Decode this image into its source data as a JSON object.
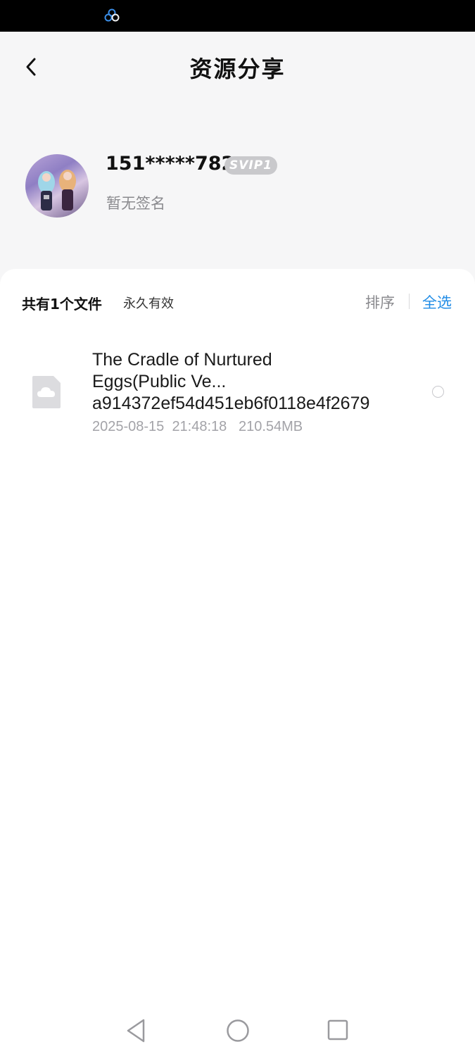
{
  "header": {
    "title": "资源分享",
    "back_icon": "chevron-left-icon"
  },
  "profile": {
    "username": "151*****782",
    "vip_badge": "SVIP1",
    "signature": "暂无签名"
  },
  "files_header": {
    "count_label": "共有1个文件",
    "validity_label": "永久有效",
    "sort_label": "排序",
    "select_all_label": "全选"
  },
  "files": [
    {
      "name_line1": "The Cradle of Nurtured",
      "name_line2": "Eggs(Public Ve...",
      "name_line3": "a914372ef54d451eb6f0118e4f2679",
      "date": "2025-08-15",
      "time": "21:48:18",
      "size": "210.54MB",
      "icon": "cloud-file-icon",
      "selected": false
    }
  ],
  "colors": {
    "accent": "#1e8be6",
    "background": "#f6f6f7",
    "text_secondary": "#8a8a8e"
  },
  "nav": {
    "back_icon": "triangle-back-icon",
    "home_icon": "circle-home-icon",
    "recent_icon": "square-recent-icon"
  }
}
